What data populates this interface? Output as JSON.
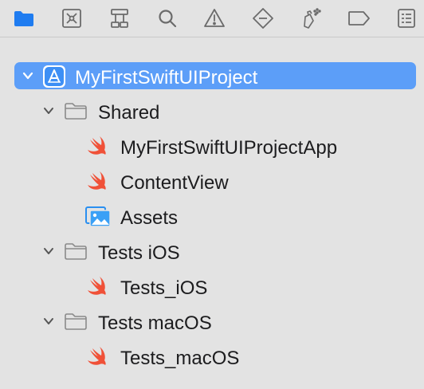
{
  "toolbar": {
    "icons": [
      {
        "name": "folder-navigator-icon",
        "active": true
      },
      {
        "name": "source-control-icon"
      },
      {
        "name": "symbol-hierarchy-icon"
      },
      {
        "name": "search-icon"
      },
      {
        "name": "warning-icon"
      },
      {
        "name": "test-diamond-icon"
      },
      {
        "name": "debug-spray-icon"
      },
      {
        "name": "breakpoint-tag-icon"
      },
      {
        "name": "report-list-icon"
      }
    ],
    "accent": "#1f7cf0"
  },
  "tree": {
    "selected_color": "#5c9ef8",
    "swift_color": "#f05138",
    "items": [
      {
        "label": "MyFirstSwiftUIProject",
        "type": "project",
        "level": 0,
        "expanded": true,
        "selected": true
      },
      {
        "label": "Shared",
        "type": "folder",
        "level": 1,
        "expanded": true
      },
      {
        "label": "MyFirstSwiftUIProjectApp",
        "type": "swift",
        "level": 2
      },
      {
        "label": "ContentView",
        "type": "swift",
        "level": 2
      },
      {
        "label": "Assets",
        "type": "assets",
        "level": 2
      },
      {
        "label": "Tests iOS",
        "type": "folder",
        "level": 1,
        "expanded": true
      },
      {
        "label": "Tests_iOS",
        "type": "swift",
        "level": 2
      },
      {
        "label": "Tests macOS",
        "type": "folder",
        "level": 1,
        "expanded": true
      },
      {
        "label": "Tests_macOS",
        "type": "swift",
        "level": 2
      }
    ]
  }
}
